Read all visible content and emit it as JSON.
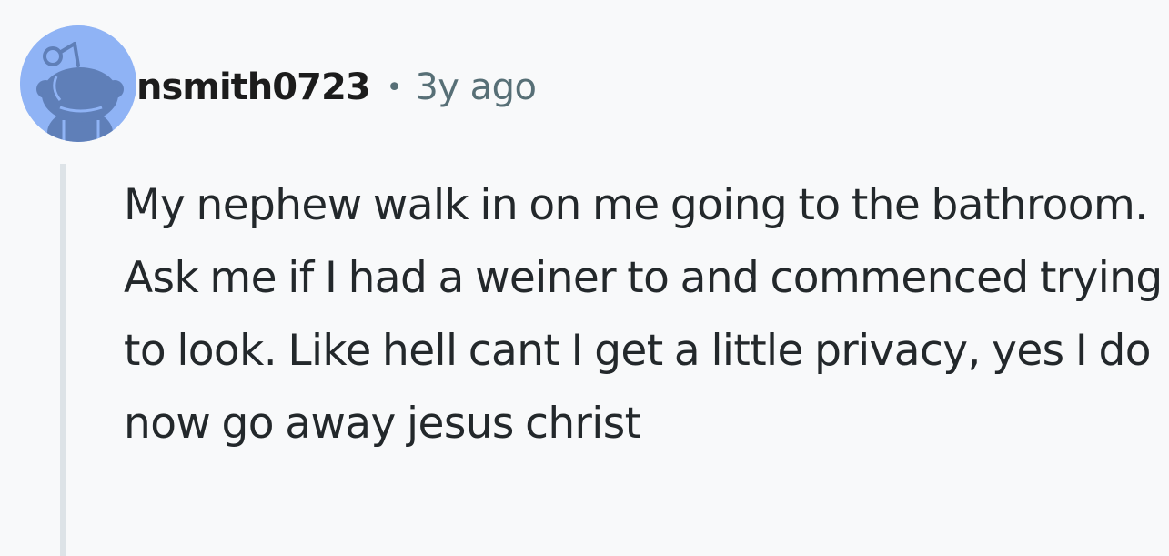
{
  "comment": {
    "author": "nsmith0723",
    "separator": "•",
    "timestamp": "3y ago",
    "body": "My nephew walk in on me going to the bathroom. Ask me if I had a weiner to and commenced trying to look. Like hell cant I get a little privacy, yes I do now go away jesus christ",
    "avatar": {
      "icon": "snoo-avatar-icon",
      "background_color": "#8fb3f5",
      "figure_color": "#5f7fb8"
    }
  },
  "colors": {
    "page_background": "#f8f9fa",
    "author_text": "#1c1c1c",
    "meta_text": "#576f76",
    "body_text": "#23282b",
    "thread_line": "#dde3e7"
  }
}
